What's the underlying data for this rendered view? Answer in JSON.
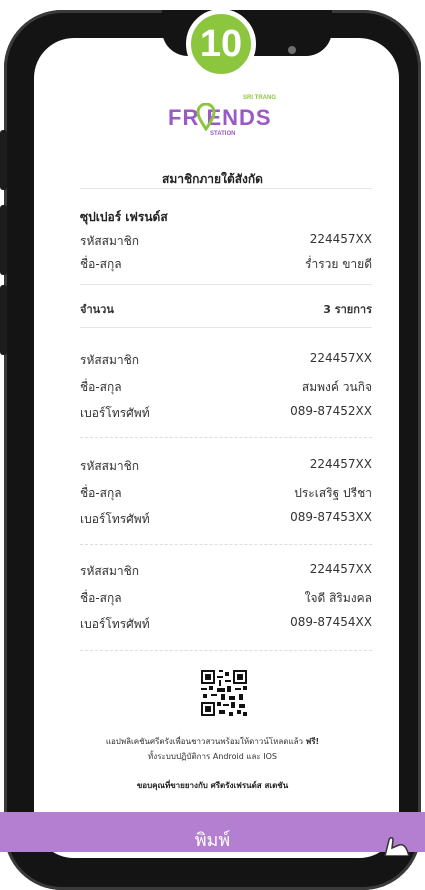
{
  "step_badge": "10",
  "logo": {
    "brand": "FR ENDS",
    "sub_top": "SRI TRANG",
    "sub_bottom": "STATION"
  },
  "page_title": "สมาชิกภายใต้สังกัด",
  "member": {
    "group_title": "ซุปเปอร์ เฟรนด์ส",
    "code_label": "รหัสสมาชิก",
    "code": "224457XX",
    "name_label": "ชื่อ-สกุล",
    "name": "ร่ำรวย ขายดี"
  },
  "count": {
    "label": "จำนวน",
    "value": "3 รายการ"
  },
  "sub_members": [
    {
      "code_label": "รหัสสมาชิก",
      "code": "224457XX",
      "name_label": "ชื่อ-สกุล",
      "name": "สมพงค์ วนกิจ",
      "phone_label": "เบอร์โทรศัพท์",
      "phone": "089-87452XX"
    },
    {
      "code_label": "รหัสสมาชิก",
      "code": "224457XX",
      "name_label": "ชื่อ-สกุล",
      "name": "ประเสริฐ ปรีชา",
      "phone_label": "เบอร์โทรศัพท์",
      "phone": "089-87453XX"
    },
    {
      "code_label": "รหัสสมาชิก",
      "code": "224457XX",
      "name_label": "ชื่อ-สกุล",
      "name": "ใจดี สิริมงคล",
      "phone_label": "เบอร์โทรศัพท์",
      "phone": "089-87454XX"
    }
  ],
  "footer": {
    "line1": "แอปพลิเคชันศรีตรังเพื่อนชาวสวนพร้อมให้ดาวน์โหลดแล้ว",
    "free": "ฟรี!",
    "line2": "ทั้งระบบปฏิบัติการ Android และ IOS",
    "thanks": "ขอบคุณที่ขายยางกับ ศรีตรังเฟรนด์ส สเตชัน"
  },
  "print_button": "พิมพ์",
  "colors": {
    "brand_purple": "#9b59c6",
    "brand_green": "#8cc63f",
    "print_bar": "#b47fd1"
  }
}
